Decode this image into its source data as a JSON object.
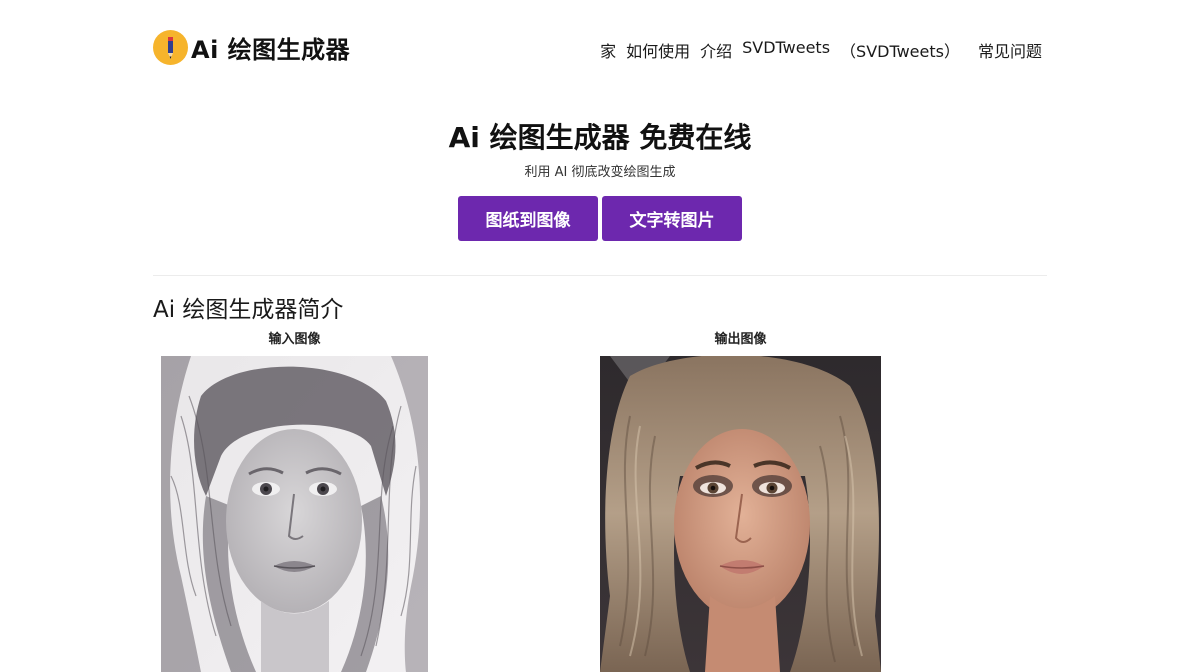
{
  "header": {
    "logo_text": "Ai 绘图生成器",
    "nav": [
      "家",
      "如何使用",
      "介绍",
      "SVDTweets",
      "（SVDTweets）",
      "常见问题"
    ]
  },
  "hero": {
    "title": "Ai 绘图生成器 免费在线",
    "subtitle": "利用 AI 彻底改变绘图生成",
    "buttons": [
      "图纸到图像",
      "文字转图片"
    ]
  },
  "intro": {
    "title": "Ai 绘图生成器简介",
    "input_caption": "输入图像",
    "output_caption": "输出图像"
  },
  "colors": {
    "accent": "#6d28ae",
    "logo_badge": "#f6b42c"
  }
}
